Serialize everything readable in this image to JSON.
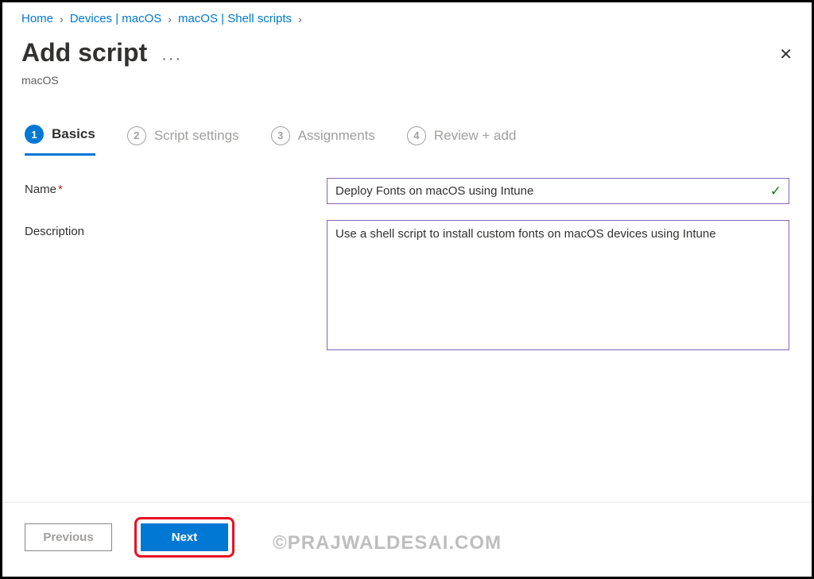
{
  "breadcrumb": [
    {
      "label": "Home"
    },
    {
      "label": "Devices | macOS"
    },
    {
      "label": "macOS | Shell scripts"
    }
  ],
  "header": {
    "title": "Add script",
    "subtitle": "macOS"
  },
  "tabs": [
    {
      "num": "1",
      "label": "Basics",
      "active": true
    },
    {
      "num": "2",
      "label": "Script settings",
      "active": false
    },
    {
      "num": "3",
      "label": "Assignments",
      "active": false
    },
    {
      "num": "4",
      "label": "Review + add",
      "active": false
    }
  ],
  "form": {
    "name_label": "Name",
    "name_value": "Deploy Fonts on macOS using Intune",
    "description_label": "Description",
    "description_value": "Use a shell script to install custom fonts on macOS devices using Intune"
  },
  "footer": {
    "previous_label": "Previous",
    "next_label": "Next"
  },
  "watermark": "©PRAJWALDESAI.COM"
}
